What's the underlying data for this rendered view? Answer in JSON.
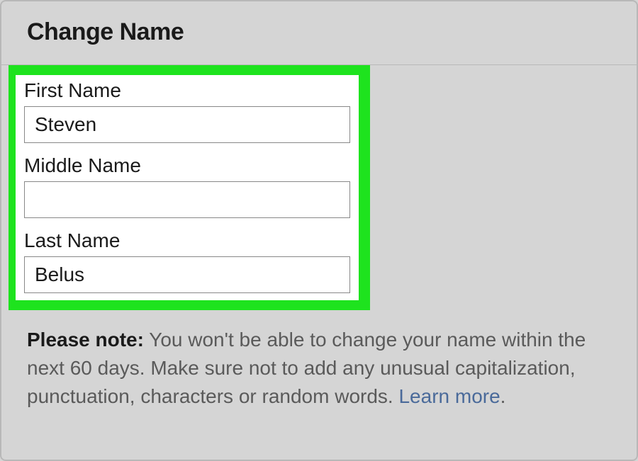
{
  "header": {
    "title": "Change Name"
  },
  "form": {
    "first_name": {
      "label": "First Name",
      "value": "Steven"
    },
    "middle_name": {
      "label": "Middle Name",
      "value": ""
    },
    "last_name": {
      "label": "Last Name",
      "value": "Belus"
    }
  },
  "note": {
    "bold": "Please note:",
    "text": " You won't be able to change your name within the next 60 days. Make sure not to add any unusual capitalization, punctuation, characters or random words. ",
    "link": "Learn more",
    "period": "."
  }
}
